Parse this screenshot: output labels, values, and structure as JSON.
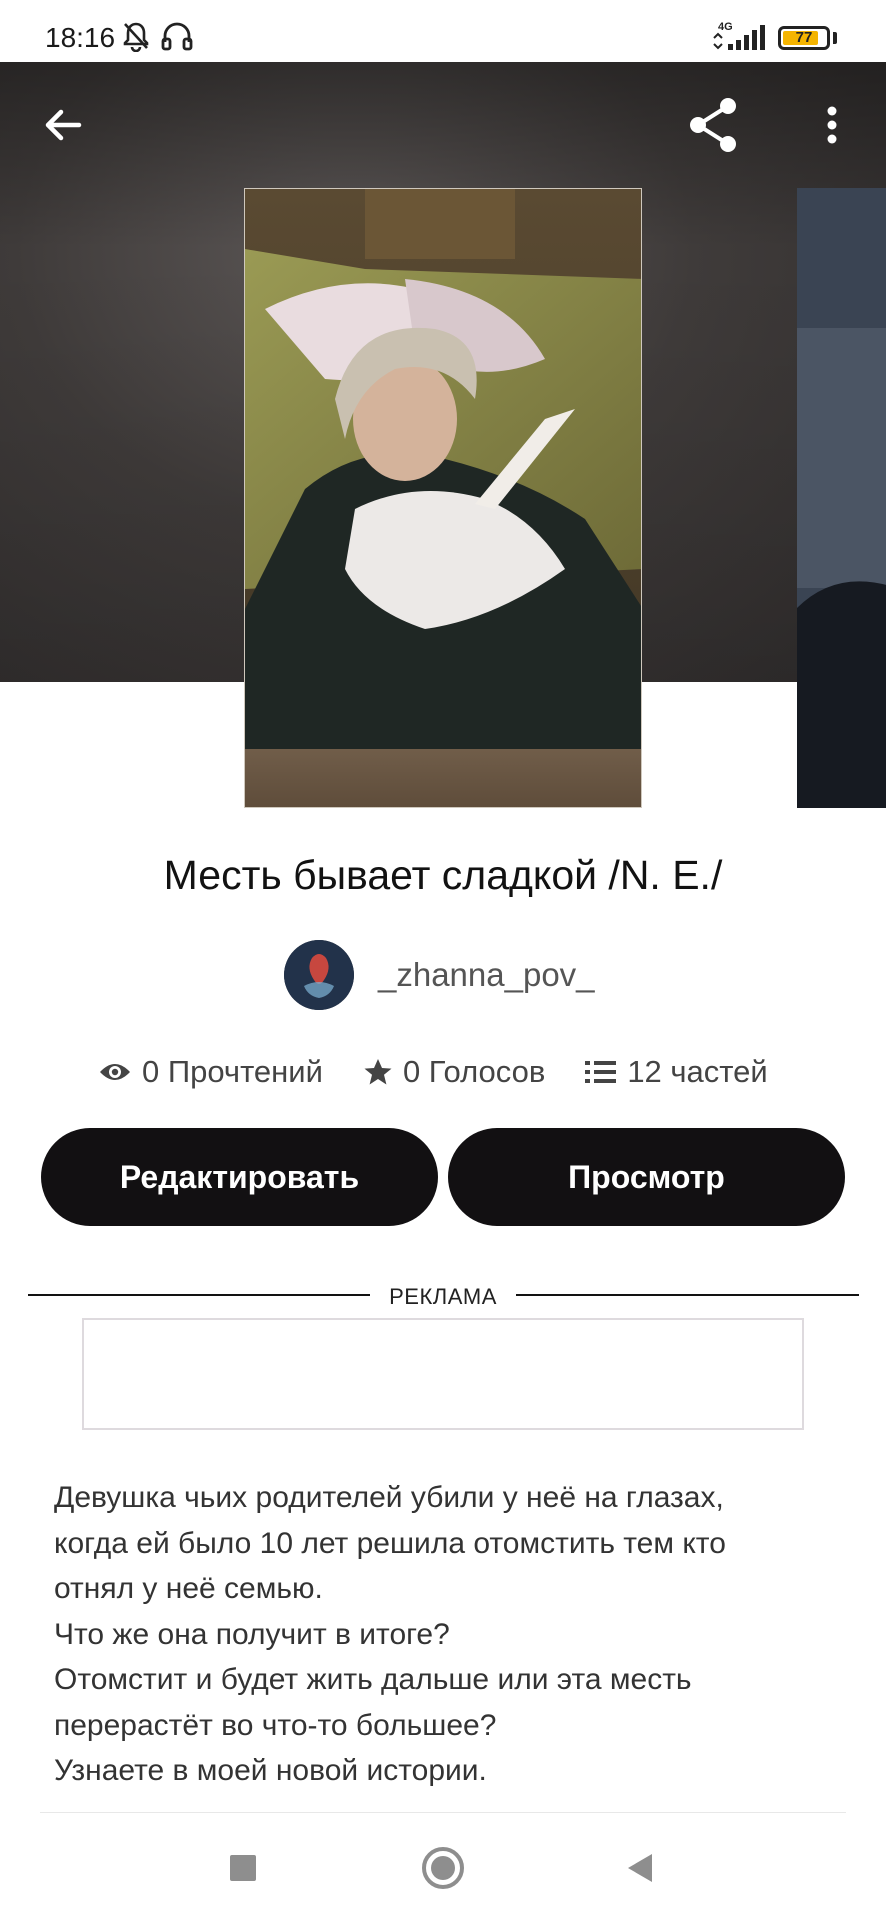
{
  "status_bar": {
    "time": "18:16",
    "network": "4G",
    "battery": "77",
    "battery_level": 0.77,
    "icons": [
      "bell-off-icon",
      "headset-icon",
      "signal-icon",
      "battery-icon"
    ],
    "battery_color": "#f4b400"
  },
  "toolbar": {
    "back_icon": "arrow-left-icon",
    "share_icon": "share-icon",
    "more_icon": "more-vertical-icon"
  },
  "story": {
    "title": "Месть бывает сладкой /N. E./",
    "author": "_zhanna_pov_",
    "stats": {
      "reads": "0 Прочтений",
      "votes": "0 Голосов",
      "parts": "12 частей"
    },
    "description": "Девушка чьих родителей убили у неё на глазах,\nкогда ей было 10 лет решила отомстить тем кто\nотнял у неё семью.\nЧто же она получит в итоге?\nОтомстит и будет жить дальше или эта месть\nперерастёт во что-то большее?\nУзнаете в моей новой истории."
  },
  "actions": {
    "edit_label": "Редактировать",
    "preview_label": "Просмотр",
    "button_color": "#121012"
  },
  "ad": {
    "label": "РЕКЛАМА"
  },
  "nav": {
    "recents_icon": "square-icon",
    "home_icon": "circle-icon",
    "back_icon": "triangle-back-icon"
  }
}
